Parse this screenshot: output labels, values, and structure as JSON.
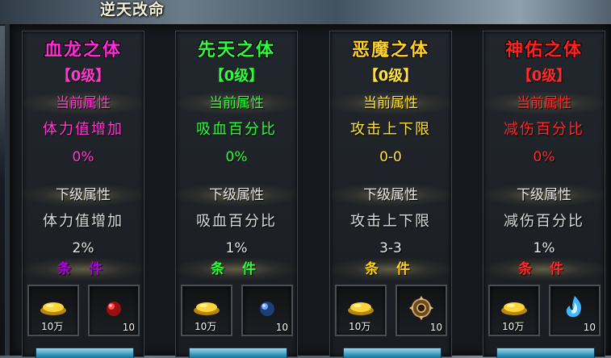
{
  "title": "逆天改命",
  "panels": [
    {
      "name": "血龙之体",
      "level": "【0级】",
      "current_header": "当前属性",
      "current_stat": "体力值增加",
      "current_value": "0%",
      "next_header": "下级属性",
      "next_stat": "体力值增加",
      "next_value": "2%",
      "condition_label": "条 件",
      "items": [
        {
          "icon": "gold-ingot-icon",
          "qty": "10万"
        },
        {
          "icon": "red-orb-icon",
          "qty": "10"
        }
      ],
      "colors": {
        "name": "#ff2ad8",
        "level": "#ff3ad0",
        "current": "#ff3ad0",
        "condition": "#b000e0"
      }
    },
    {
      "name": "先天之体",
      "level": "【0级】",
      "current_header": "当前属性",
      "current_stat": "吸血百分比",
      "current_value": "0%",
      "next_header": "下级属性",
      "next_stat": "吸血百分比",
      "next_value": "1%",
      "condition_label": "条 件",
      "items": [
        {
          "icon": "gold-ingot-icon",
          "qty": "10万"
        },
        {
          "icon": "blue-orb-icon",
          "qty": "10"
        }
      ],
      "colors": {
        "name": "#2cff3a",
        "level": "#2cff3a",
        "current": "#2cff3a",
        "condition": "#2cff3a"
      }
    },
    {
      "name": "恶魔之体",
      "level": "【0级】",
      "current_header": "当前属性",
      "current_stat": "攻击上下限",
      "current_value": "0-0",
      "next_header": "下级属性",
      "next_stat": "攻击上下限",
      "next_value": "3-3",
      "condition_label": "条 件",
      "items": [
        {
          "icon": "gold-ingot-icon",
          "qty": "10万"
        },
        {
          "icon": "demon-gear-icon",
          "qty": "10"
        }
      ],
      "colors": {
        "name": "#ffcf2a",
        "level": "#ffe23a",
        "current": "#ffe23a",
        "condition": "#ffd21a"
      }
    },
    {
      "name": "神佑之体",
      "level": "【0级】",
      "current_header": "当前属性",
      "current_stat": "减伤百分比",
      "current_value": "0%",
      "next_header": "下级属性",
      "next_stat": "减伤百分比",
      "next_value": "1%",
      "condition_label": "条 件",
      "items": [
        {
          "icon": "gold-ingot-icon",
          "qty": "10万"
        },
        {
          "icon": "blue-flame-icon",
          "qty": "10"
        }
      ],
      "colors": {
        "name": "#ff2020",
        "level": "#ff2a2a",
        "current": "#ff2a2a",
        "condition": "#ff2a2a"
      }
    }
  ]
}
